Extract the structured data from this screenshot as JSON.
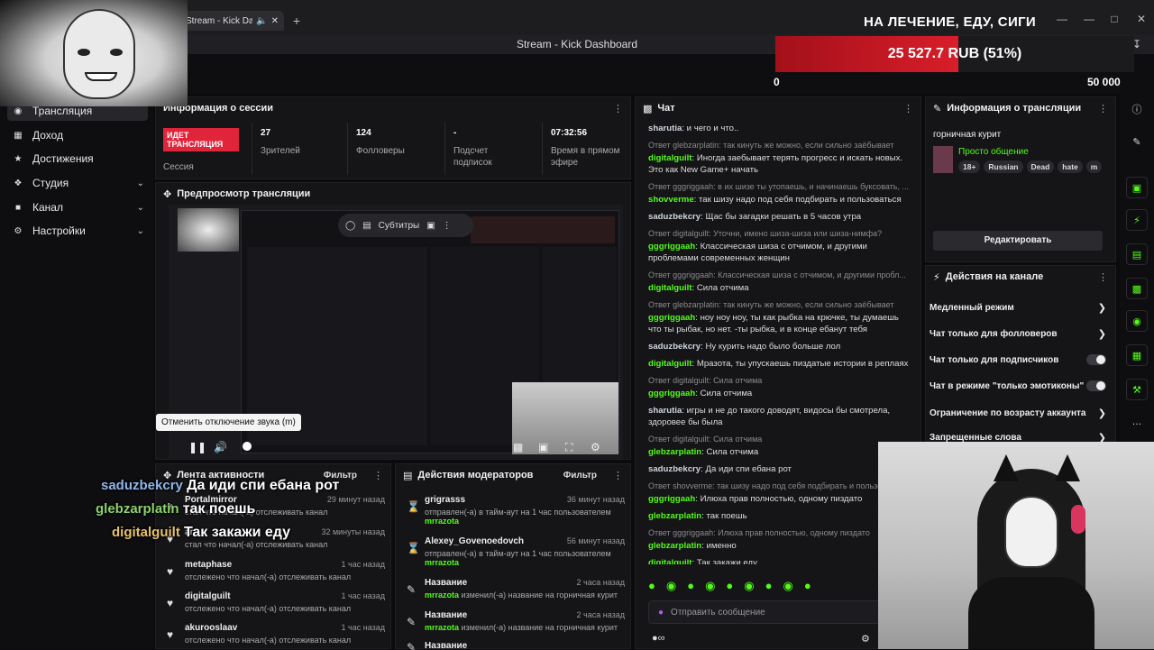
{
  "browser": {
    "tab_title": "Stream - Kick Dashb",
    "window_title": "Stream - Kick Dashboard",
    "new_tab": "+"
  },
  "overlay": {
    "goal_title": "НА ЛЕЧЕНИЕ, ЕДУ, СИГИ",
    "goal_amount": "25 527.7 RUB (51%)",
    "goal_progress_percent": 51,
    "goal_min": "0",
    "goal_max": "50 000",
    "chat_lines": [
      {
        "name": "saduzbekcry",
        "text": "Да иди спи ебана рот"
      },
      {
        "name": "glebzarplatin",
        "text": "так поешь"
      },
      {
        "name": "digitalguilt",
        "text": "Так закажи еду"
      }
    ]
  },
  "sidebar": {
    "items": [
      {
        "label": "Трансляция",
        "icon": "broadcast-icon"
      },
      {
        "label": "Доход",
        "icon": "money-icon"
      },
      {
        "label": "Достижения",
        "icon": "trophy-icon"
      },
      {
        "label": "Студия",
        "icon": "studio-icon"
      },
      {
        "label": "Канал",
        "icon": "channel-icon"
      },
      {
        "label": "Настройки",
        "icon": "gear-icon"
      }
    ]
  },
  "session": {
    "title": "Информация о сессии",
    "live_badge": "ИДЕТ ТРАНСЛЯЦИЯ",
    "session_label": "Сессия",
    "stats": [
      {
        "value": "27",
        "label": "Зрителей"
      },
      {
        "value": "124",
        "label": "Фолловеры"
      },
      {
        "value": "-",
        "label": "Подсчет подписок"
      },
      {
        "value": "07:32:56",
        "label": "Время в прямом эфире"
      }
    ]
  },
  "preview": {
    "title": "Предпросмотр трансляции",
    "subtitles_label": "Субтитры",
    "tooltip": "Отменить отключение звука (m)"
  },
  "activity": {
    "title": "Лента активности",
    "filter": "Фильтр",
    "items": [
      {
        "name": "Portalmirror",
        "time": "29 минут назад",
        "desc": "стал что начал(-а) отслеживать канал"
      },
      {
        "name": "ar",
        "time": "32 минуты назад",
        "desc": "стал что начал(-а) отслеживать канал"
      },
      {
        "name": "metaphase",
        "time": "1 час назад",
        "desc": "отслежено что начал(-а) отслеживать канал"
      },
      {
        "name": "digitalguilt",
        "time": "1 час назад",
        "desc": "отслежено что начал(-а) отслеживать канал"
      },
      {
        "name": "akurooslaav",
        "time": "1 час назад",
        "desc": "отслежено что начал(-а) отслеживать канал"
      }
    ]
  },
  "mod_actions": {
    "title": "Действия модераторов",
    "filter": "Фильтр",
    "items": [
      {
        "name": "grigrasss",
        "time": "36 минут назад",
        "desc_pre": "отправлен(-а) в тайм-аут на 1 час пользователем",
        "mod": "mrrazota",
        "desc_post": ""
      },
      {
        "name": "Alexey_Govenoedovch",
        "time": "56 минут назад",
        "desc_pre": "отправлен(-а) в тайм-аут на 1 час пользователем",
        "mod": "mrrazota",
        "desc_post": ""
      },
      {
        "name": "Название",
        "time": "2 часа назад",
        "desc_pre": "",
        "mod": "mrrazota",
        "desc_post": "изменил(-а) название на горничная курит"
      },
      {
        "name": "Название",
        "time": "2 часа назад",
        "desc_pre": "",
        "mod": "mrrazota",
        "desc_post": "изменил(-а) название на горничная курит"
      },
      {
        "name": "Название",
        "time": "",
        "desc_pre": "",
        "mod": "",
        "desc_post": ""
      }
    ]
  },
  "chat": {
    "title": "Чат",
    "input_placeholder": "Отправить сообщение",
    "messages": [
      {
        "reply": "",
        "user": "sharutia",
        "green": false,
        "text": "и чего и что.."
      },
      {
        "reply": "Ответ glebzarplatin: так кинуть же можно, если сильно заёбывает",
        "user": "digitalguilt",
        "green": true,
        "text": "Иногда заебывает терять прогресс и искать новых. Это как New Game+ начать"
      },
      {
        "reply": "Ответ gggriggaah: в их шизе ты утопаешь, и начинаешь буксовать, ...",
        "user": "shovverme",
        "green": true,
        "text": "так шизу надо под себя подбирать и пользоваться"
      },
      {
        "reply": "",
        "user": "saduzbekcry",
        "green": false,
        "text": "Щас бы загадки решать в 5 часов утра"
      },
      {
        "reply": "Ответ digitalguilt: Уточни, имено шиза-шиза или шиза-нимфа?",
        "user": "gggriggaah",
        "green": true,
        "text": "Классическая шиза с отчимом, и другими проблемами современных женщин"
      },
      {
        "reply": "Ответ gggriggaah: Классическая шиза с отчимом, и другими пробл...",
        "user": "digitalguilt",
        "green": true,
        "text": "Сила отчима"
      },
      {
        "reply": "Ответ glebzarplatin: так кинуть же можно, если сильно заёбывает",
        "user": "gggriggaah",
        "green": true,
        "text": "ноу ноу ноу, ты как рыбка на крючке, ты думаешь что ты рыбак, но нет. -ты рыбка, и в конце ебанут тебя"
      },
      {
        "reply": "",
        "user": "saduzbekcry",
        "green": false,
        "text": "Ну курить надо было больше лол"
      },
      {
        "reply": "",
        "user": "digitalguilt",
        "green": true,
        "text": "Мразота, ты упускаешь пиздатые истории в реплаях"
      },
      {
        "reply": "Ответ digitalguilt: Сила отчима",
        "user": "gggriggaah",
        "green": true,
        "text": "Сила отчима"
      },
      {
        "reply": "",
        "user": "sharutia",
        "green": false,
        "text": "игры и не до такого доводят, видосы бы смотрела, здоровее бы была"
      },
      {
        "reply": "Ответ digitalguilt: Сила отчима",
        "user": "glebzarplatin",
        "green": true,
        "text": "Сила отчима"
      },
      {
        "reply": "",
        "user": "saduzbekcry",
        "green": false,
        "text": "Да иди спи ебана рот"
      },
      {
        "reply": "Ответ shovverme: так шизу надо под себя подбирать и пользо",
        "user": "gggriggaah",
        "green": true,
        "text": "Илюха прав полностью, одному пиздато"
      },
      {
        "reply": "",
        "user": "glebzarplatin",
        "green": true,
        "text": "так поешь"
      },
      {
        "reply": "Ответ gggriggaah: Илюха прав полностью, одному пиздато",
        "user": "glebzarplatin",
        "green": true,
        "text": "именно"
      },
      {
        "reply": "",
        "user": "digitalguilt",
        "green": true,
        "text": "Так закажи еду"
      }
    ]
  },
  "stream_info": {
    "title": "Информация о трансляции",
    "stream_title": "горничная курит",
    "category": "Просто общение",
    "tags": [
      "18+",
      "Russian",
      "Dead",
      "hate",
      "m"
    ],
    "edit_button": "Редактировать"
  },
  "channel_actions": {
    "title": "Действия на канале",
    "items": [
      {
        "label": "Медленный режим",
        "control": "chevron"
      },
      {
        "label": "Чат только для фолловеров",
        "control": "chevron"
      },
      {
        "label": "Чат только для подписчиков",
        "control": "toggle"
      },
      {
        "label": "Чат в режиме \"только эмотиконы\"",
        "control": "toggle"
      },
      {
        "label": "Ограничение по возрасту аккаунта",
        "control": "chevron"
      },
      {
        "label": "Запрещенные слова",
        "control": "chevron"
      }
    ]
  },
  "colors": {
    "accent": "#53fc18",
    "live": "#e0243a",
    "goal_fill": "#d81e2a"
  }
}
